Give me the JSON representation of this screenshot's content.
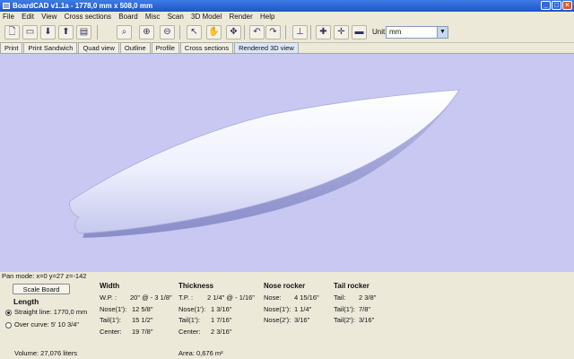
{
  "window": {
    "title": "BoardCAD v1.1a -  1778,0 mm x 508,0 mm",
    "minimize": "_",
    "maximize": "□",
    "close": "×"
  },
  "menu": [
    "File",
    "Edit",
    "View",
    "Cross sections",
    "Board",
    "Misc",
    "Scan",
    "3D Model",
    "Render",
    "Help"
  ],
  "toolbar": {
    "icons": [
      "new-file-icon",
      "open-file-icon",
      "save-icon",
      "save-as-icon",
      "print-icon",
      "zoom-fit-icon",
      "zoom-in-icon",
      "zoom-out-icon",
      "select-arrow-icon",
      "pan-hand-icon",
      "rotate-icon",
      "undo-icon",
      "redo-icon",
      "center-point-icon",
      "add-point-icon",
      "add-crosssection-icon",
      "delete-crosssection-icon"
    ],
    "unit_label": "Unit:",
    "unit_value": "mm"
  },
  "tabs": [
    "Print",
    "Print Sandwich",
    "Quad view",
    "Outline",
    "Profile",
    "Cross sections",
    "Rendered 3D view"
  ],
  "active_tab": "Rendered 3D view",
  "status": "Pan mode: x=0 y=27 z=-142",
  "panel": {
    "scale_button": "Scale Board",
    "length_heading": "Length",
    "straight_line": "Straight line: 1770,0 mm",
    "over_curve": "Over curve: 5' 10 3/4\"",
    "volume": "Volume: 27,076 liters",
    "area": "Area: 0,676 m²",
    "width": {
      "heading": "Width",
      "rows": [
        {
          "k": "W.P. :",
          "v": "20\" @ - 3 1/8\""
        },
        {
          "k": "Nose(1'):",
          "v": "12 5/8\""
        },
        {
          "k": "Tail(1'):",
          "v": "15 1/2\""
        },
        {
          "k": "Center:",
          "v": "19 7/8\""
        }
      ]
    },
    "thickness": {
      "heading": "Thickness",
      "rows": [
        {
          "k": "T.P. :",
          "v": "2 1/4\" @ - 1/16\""
        },
        {
          "k": "Nose(1'):",
          "v": "1 3/16\""
        },
        {
          "k": "Tail(1'):",
          "v": "1 7/16\""
        },
        {
          "k": "Center:",
          "v": "2 3/16\""
        }
      ]
    },
    "nose_rocker": {
      "heading": "Nose rocker",
      "rows": [
        {
          "k": "Nose:",
          "v": "4 15/16\""
        },
        {
          "k": "Nose(1'):",
          "v": "1 1/4\""
        },
        {
          "k": "Nose(2'):",
          "v": "3/16\""
        }
      ]
    },
    "tail_rocker": {
      "heading": "Tail rocker",
      "rows": [
        {
          "k": "Tail:",
          "v": "2 3/8\""
        },
        {
          "k": "Tail(1'):",
          "v": "7/8\""
        },
        {
          "k": "Tail(2'):",
          "v": "3/16\""
        }
      ]
    }
  }
}
